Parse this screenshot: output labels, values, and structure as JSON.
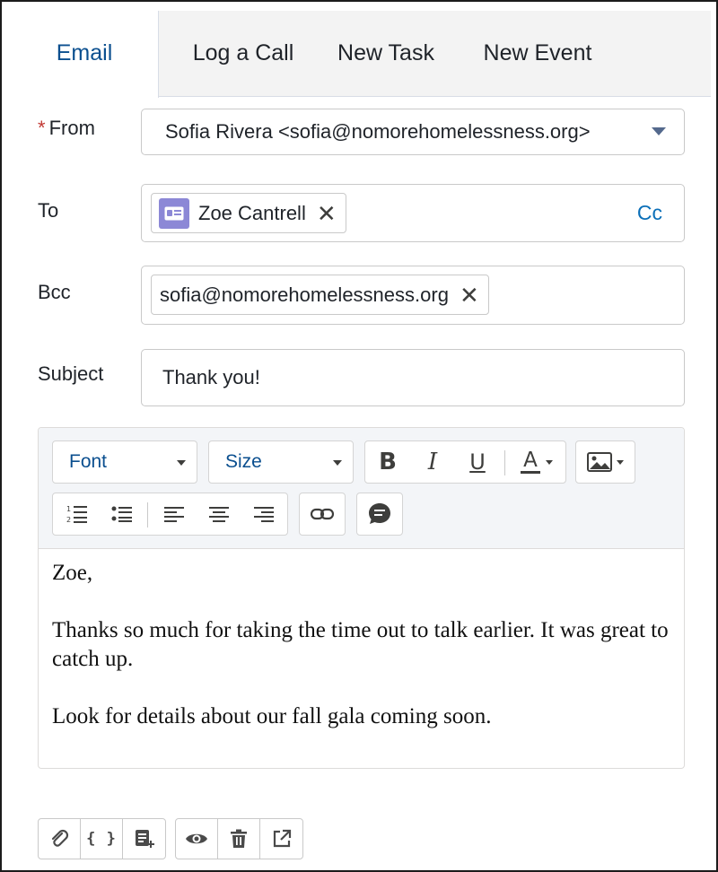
{
  "tabs": [
    {
      "label": "Email",
      "active": true
    },
    {
      "label": "Log a Call",
      "active": false
    },
    {
      "label": "New Task",
      "active": false
    },
    {
      "label": "New Event",
      "active": false
    }
  ],
  "form": {
    "required_marker": "*",
    "from_label": "From",
    "from_value": "Sofia Rivera <sofia@nomorehomelessness.org>",
    "to_label": "To",
    "to_recipients": [
      {
        "name": "Zoe Cantrell",
        "icon": "contact-card-icon"
      }
    ],
    "cc_link": "Cc",
    "bcc_label": "Bcc",
    "bcc_recipients": [
      {
        "name": "sofia@nomorehomelessness.org"
      }
    ],
    "subject_label": "Subject",
    "subject_value": "Thank you!",
    "remove_glyph": "✕"
  },
  "toolbar": {
    "font_label": "Font",
    "size_label": "Size",
    "bold": "B",
    "italic": "I",
    "underline": "U",
    "text_color": "A"
  },
  "editor": {
    "paragraphs": [
      "Zoe,",
      "Thanks so much for taking the time out to talk earlier. It was great to catch up.",
      "Look for details about our fall gala coming soon."
    ]
  },
  "actions": {
    "braces": "{ }"
  },
  "colors": {
    "accent": "#0b4f8f",
    "link": "#0b6fb8",
    "required": "#c23934",
    "avatar": "#8c88d6"
  }
}
